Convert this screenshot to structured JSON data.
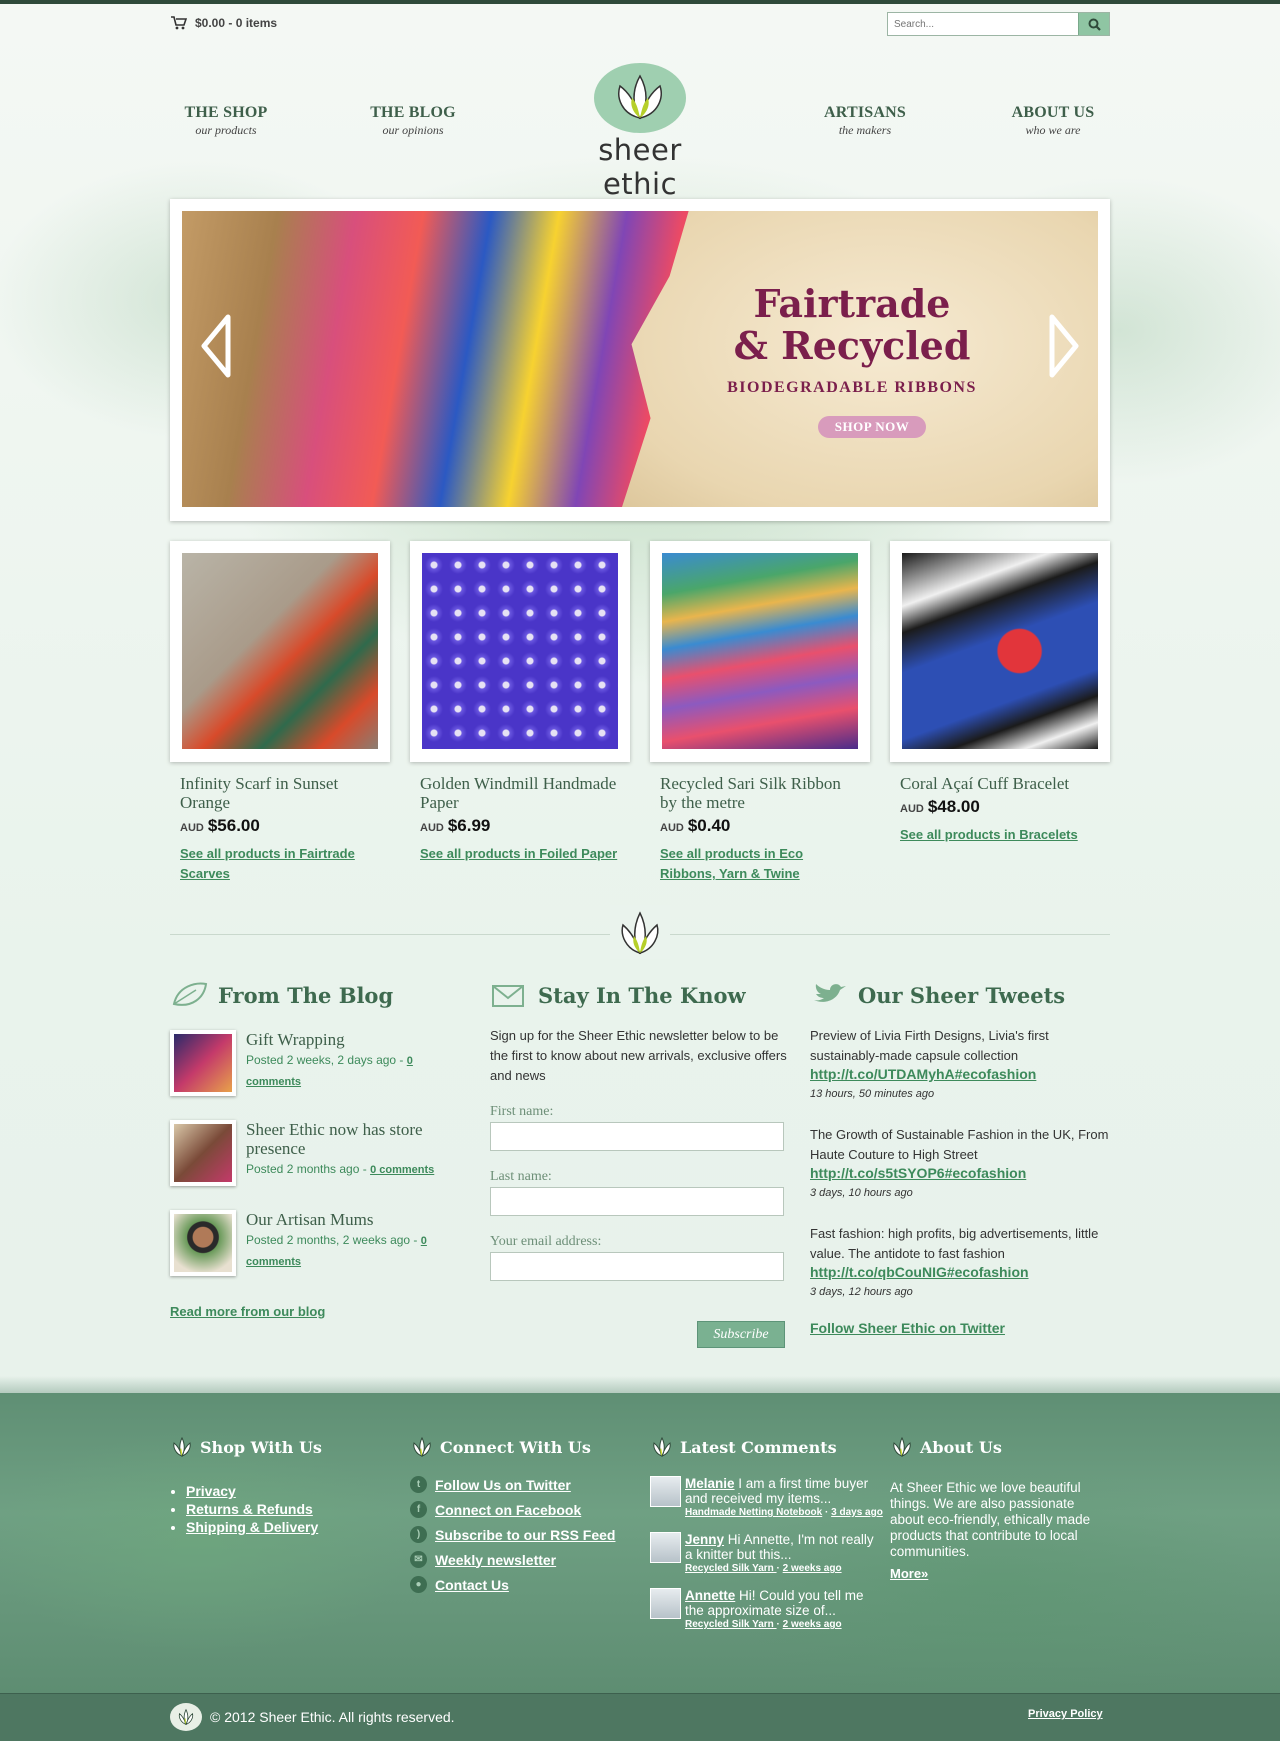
{
  "header": {
    "cart": "$0.00 - 0 items",
    "search_placeholder": "Search...",
    "nav": [
      {
        "title": "THE SHOP",
        "sub": "our products"
      },
      {
        "title": "THE BLOG",
        "sub": "our opinions"
      },
      {
        "title": "ARTISANS",
        "sub": "the makers"
      },
      {
        "title": "ABOUT US",
        "sub": "who we are"
      }
    ],
    "logo_text": "sheer ethic"
  },
  "hero": {
    "title_line1": "Fairtrade",
    "title_line2": "& Recycled",
    "subtitle": "BIODEGRADABLE RIBBONS",
    "button": "SHOP NOW"
  },
  "products": [
    {
      "name": "Infinity Scarf in Sunset Orange",
      "currency": "AUD",
      "price": "$56.00",
      "link": "See all products in Fairtrade Scarves",
      "colors": [
        "#d84a2a",
        "#2f6a4c",
        "#b9b4a7"
      ]
    },
    {
      "name": "Golden Windmill Handmade Paper",
      "currency": "AUD",
      "price": "$6.99",
      "link": "See all products in Foiled Paper",
      "colors": [
        "#4a35c8",
        "#6a57e0",
        "#e6e2f4"
      ]
    },
    {
      "name": "Recycled Sari Silk Ribbon by the metre",
      "currency": "AUD",
      "price": "$0.40",
      "link": "See all products in Eco Ribbons, Yarn & Twine",
      "colors": [
        "#3a8bd1",
        "#e9506d",
        "#8c5ac0"
      ]
    },
    {
      "name": "Coral Açaí Cuff Bracelet",
      "currency": "AUD",
      "price": "$48.00",
      "link": "See all products in Bracelets",
      "colors": [
        "#1b1b1b",
        "#2d4fb4",
        "#e2353b"
      ]
    }
  ],
  "blog": {
    "heading": "From The Blog",
    "items": [
      {
        "title": "Gift Wrapping",
        "meta": "Posted 2 weeks, 2 days ago - ",
        "comments": "0 comments"
      },
      {
        "title": "Sheer Ethic now has store presence",
        "meta": "Posted 2 months ago - ",
        "comments": "0 comments"
      },
      {
        "title": "Our Artisan Mums",
        "meta": "Posted 2 months, 2 weeks ago - ",
        "comments": "0 comments"
      }
    ],
    "read_more": "Read more from our blog"
  },
  "newsletter": {
    "heading": "Stay In The Know",
    "intro": "Sign up for the Sheer Ethic newsletter below to be the first to know about new arrivals, exclusive offers and news",
    "first_name": "First name:",
    "last_name": "Last name:",
    "email": "Your email address:",
    "subscribe": "Subscribe"
  },
  "tweets": {
    "heading": "Our Sheer Tweets",
    "items": [
      {
        "text": "Preview of Livia Firth Designs, Livia's first sustainably-made capsule collection",
        "link": "http://t.co/UTDAMyhA#ecofashion",
        "when": "13 hours, 50 minutes ago"
      },
      {
        "text": "The Growth of Sustainable Fashion in the UK, From Haute Couture to High Street",
        "link": "http://t.co/s5tSYOP6#ecofashion",
        "when": "3 days, 10 hours ago"
      },
      {
        "text": "Fast fashion: high profits, big advertisements, little value. The antidote to fast fashion",
        "link": "http://t.co/qbCouNIG#ecofashion",
        "when": "3 days, 12 hours ago"
      }
    ],
    "follow": "Follow Sheer Ethic on Twitter"
  },
  "footer": {
    "shop_heading": "Shop With Us",
    "shop_links": [
      "Privacy",
      "Returns & Refunds",
      "Shipping & Delivery"
    ],
    "connect_heading": "Connect With Us",
    "connect_links": [
      {
        "label": "Follow Us on Twitter",
        "icon": "twitter-icon"
      },
      {
        "label": "Connect on Facebook",
        "icon": "facebook-icon"
      },
      {
        "label": "Subscribe to our RSS Feed",
        "icon": "rss-icon"
      },
      {
        "label": "Weekly newsletter",
        "icon": "mail-icon"
      },
      {
        "label": "Contact Us",
        "icon": "chat-icon"
      }
    ],
    "comments_heading": "Latest Comments",
    "comments": [
      {
        "author": "Melanie",
        "text": " I am a first time buyer and received my items...",
        "post": "Handmade Netting Notebook",
        "when": "3 days ago"
      },
      {
        "author": "Jenny",
        "text": " Hi Annette, I'm not really a knitter but this...",
        "post": "Recycled Silk Yarn ",
        "when": "2 weeks ago"
      },
      {
        "author": "Annette",
        "text": " Hi! Could you tell me the approximate size of...",
        "post": "Recycled Silk Yarn ",
        "when": "2 weeks ago"
      }
    ],
    "about_heading": "About Us",
    "about_text": "At Sheer Ethic we love beautiful things. We are also passionate about eco-friendly, ethically made products that contribute to local communities.",
    "about_more": "More»",
    "copyright": "© 2012 Sheer Ethic. All rights reserved.",
    "privacy": "Privacy Policy"
  },
  "colors": {
    "brand_green": "#3e6a4f",
    "link_green": "#3d8a5b",
    "accent_plum": "#7b1f4c",
    "footer_green": "#5f8f74"
  }
}
